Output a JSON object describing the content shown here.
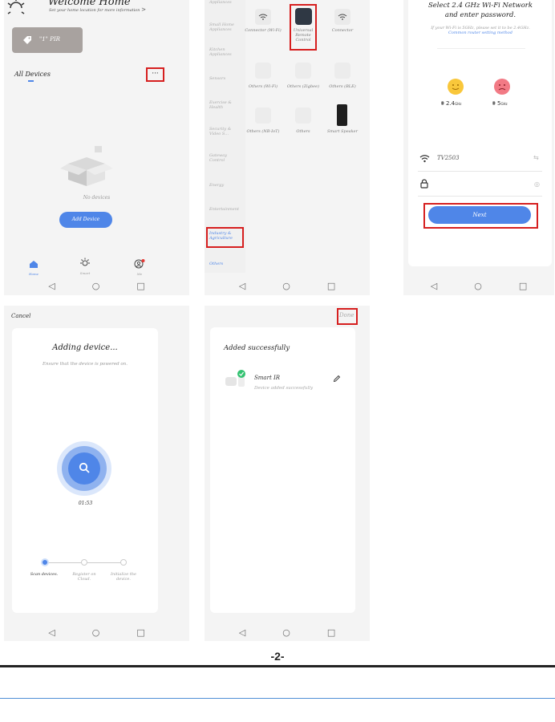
{
  "screen1": {
    "welcome_title": "Welcome Home",
    "welcome_subtitle": "Set your home location for more information",
    "chevron": ">",
    "scene_label": "\"1\" PIR",
    "all_devices": "All Devices",
    "more_glyph": "···",
    "no_devices": "No devices",
    "add_device": "Add Device",
    "tabs": [
      {
        "label": "Home"
      },
      {
        "label": "Smart"
      },
      {
        "label": "Me"
      }
    ]
  },
  "screen2": {
    "categories": [
      "Appliances",
      "Small Home Appliances",
      "Kitchen Appliances",
      "Sensors",
      "Exercise & Health",
      "Security & Video S…",
      "Gateway Control",
      "Energy",
      "Entertainment",
      "Industry & Agriculture",
      "Others"
    ],
    "devices": [
      {
        "label": "Connector (Wi-Fi)"
      },
      {
        "label": "Universal Remote Control"
      },
      {
        "label": "Connector"
      },
      {
        "label": "Others (Wi-Fi)"
      },
      {
        "label": "Others (Zigbee)"
      },
      {
        "label": "Others (BLE)"
      },
      {
        "label": "Others (NB-IoT)"
      },
      {
        "label": "Others"
      },
      {
        "label": "Smart Speaker"
      }
    ]
  },
  "screen3": {
    "title_line1": "Select 2.4 GHz Wi-Fi Network",
    "title_line2": "and enter password.",
    "hint": "If your Wi-Fi is 5GHz, please set it to be 2.4GHz.",
    "hint_link": "Common router setting method",
    "band_good": "2.4",
    "band_good_unit": "GHz",
    "band_bad": "5",
    "band_bad_unit": "GHz",
    "wifi_name": "TV2503",
    "next": "Next"
  },
  "screen4": {
    "cancel": "Cancel",
    "title": "Adding device...",
    "subtitle": "Ensure that the device is powered on.",
    "timer": "01:53",
    "steps": [
      {
        "label": "Scan devices."
      },
      {
        "label": "Register on Cloud."
      },
      {
        "label": "Initialize the device."
      }
    ]
  },
  "screen5": {
    "done": "Done",
    "title": "Added successfully",
    "device_name": "Smart IR",
    "device_status": "Device added successfully"
  },
  "footer": {
    "page_number": "-2-"
  },
  "colors": {
    "accent": "#4f86e8",
    "highlight": "#d61f1f",
    "success": "#33c271",
    "scene_tile": "#a8a29f"
  }
}
